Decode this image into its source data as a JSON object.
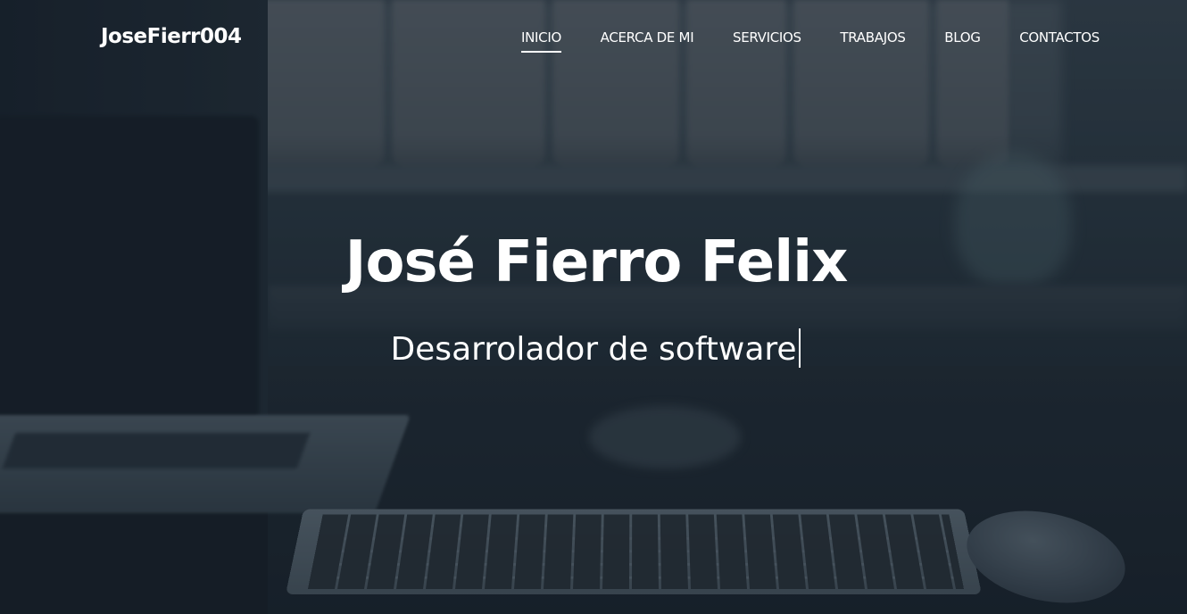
{
  "brand": {
    "name": "JoseFierr004"
  },
  "nav": {
    "items": [
      {
        "label": "INICIO",
        "active": true
      },
      {
        "label": "ACERCA DE MI",
        "active": false
      },
      {
        "label": "SERVICIOS",
        "active": false
      },
      {
        "label": "TRABAJOS",
        "active": false
      },
      {
        "label": "BLOG",
        "active": false
      },
      {
        "label": "CONTACTOS",
        "active": false
      }
    ]
  },
  "hero": {
    "title": "José Fierro Felix",
    "subtitle": "Desarrolador de software"
  }
}
